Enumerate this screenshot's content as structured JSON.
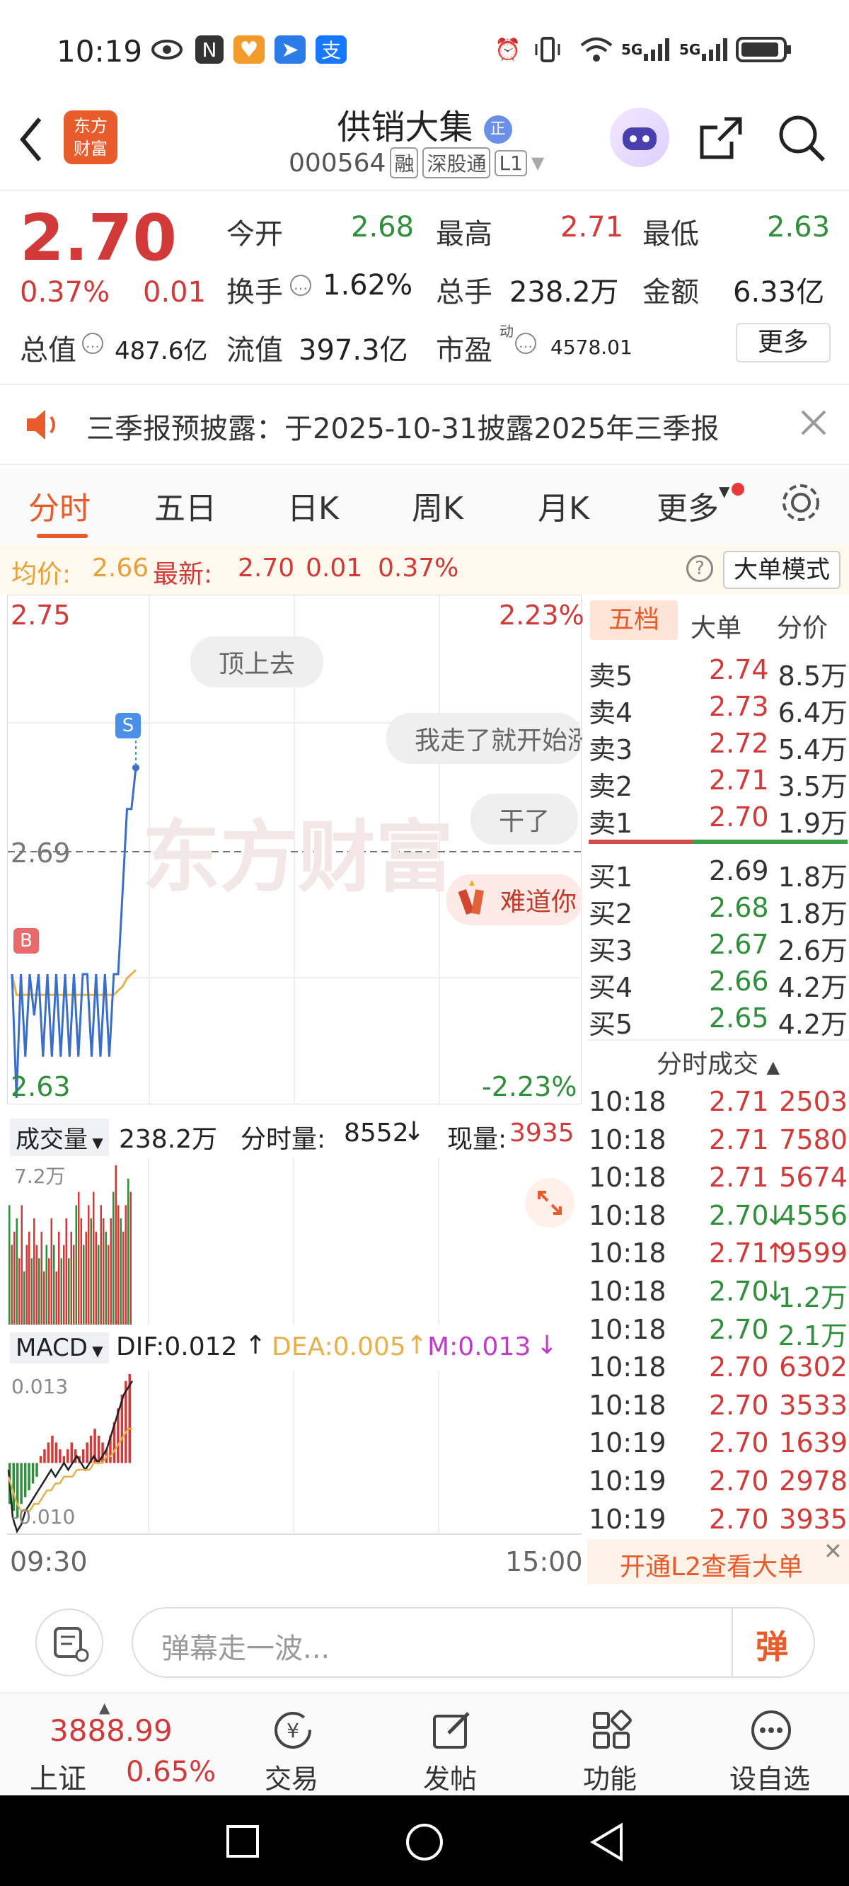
{
  "status_bar": {
    "time": "10:19",
    "signal_1": "5G",
    "signal_2": "5G"
  },
  "header": {
    "logo_text_line1": "东方",
    "logo_text_line2": "财富",
    "stock_name": "供销大集",
    "name_badge": "正",
    "stock_code": "000564",
    "tags": [
      "融",
      "深股通",
      "L1"
    ]
  },
  "quote": {
    "price": "2.70",
    "change_pct": "0.37%",
    "change_abs": "0.01",
    "open_label": "今开",
    "open": "2.68",
    "high_label": "最高",
    "high": "2.71",
    "low_label": "最低",
    "low": "2.63",
    "turnover_label": "换手",
    "turnover": "1.62%",
    "volume_label": "总手",
    "volume": "238.2万",
    "amount_label": "金额",
    "amount": "6.33亿",
    "mktcap_label": "总值",
    "mktcap": "487.6亿",
    "float_label": "流值",
    "float_cap": "397.3亿",
    "pe_label": "市盈",
    "pe_sup": "动",
    "pe": "4578.01",
    "more_button": "更多"
  },
  "notice": {
    "text": "三季报预披露：于2025-10-31披露2025年三季报"
  },
  "tabs": [
    {
      "label": "分时",
      "active": true
    },
    {
      "label": "五日"
    },
    {
      "label": "日K"
    },
    {
      "label": "周K"
    },
    {
      "label": "月K"
    },
    {
      "label": "更多"
    }
  ],
  "info_bar": {
    "avg_label": "均价:",
    "avg": "2.66",
    "latest_label": "最新:",
    "latest": "2.70",
    "chg": "0.01",
    "chg_pct": "0.37%",
    "mode_button": "大单模式"
  },
  "chart_labels": {
    "top_price": "2.75",
    "top_pct": "2.23%",
    "mid_price": "2.69",
    "bottom_price": "2.63",
    "bottom_pct": "-2.23%",
    "watermark": "东方财富",
    "s_marker": "S",
    "b_marker": "B"
  },
  "chart_data": {
    "type": "line",
    "ylim": [
      2.63,
      2.75
    ],
    "mid": 2.69,
    "price": [
      2.66,
      2.63,
      2.66,
      2.64,
      2.66,
      2.65,
      2.66,
      2.64,
      2.66,
      2.64,
      2.66,
      2.64,
      2.66,
      2.64,
      2.66,
      2.64,
      2.66,
      2.66,
      2.64,
      2.66,
      2.64,
      2.66,
      2.64,
      2.66,
      2.66,
      2.68,
      2.7,
      2.7,
      2.71
    ],
    "avg": [
      2.66,
      2.655,
      2.655,
      2.655,
      2.655,
      2.655,
      2.655,
      2.655,
      2.655,
      2.655,
      2.655,
      2.655,
      2.655,
      2.655,
      2.655,
      2.655,
      2.655,
      2.655,
      2.655,
      2.655,
      2.655,
      2.655,
      2.655,
      2.655,
      2.656,
      2.657,
      2.659,
      2.66,
      2.661
    ],
    "volume": [
      9,
      6,
      7,
      8,
      5,
      9,
      4,
      6,
      7,
      5,
      8,
      6,
      5,
      7,
      4,
      6,
      5,
      8,
      6,
      4,
      7,
      5,
      6,
      8,
      5,
      7,
      6,
      9,
      10,
      8,
      6,
      7,
      9,
      8,
      10,
      7,
      6,
      9,
      8,
      7,
      6,
      8,
      10,
      12,
      9,
      8,
      7,
      9,
      11,
      10
    ],
    "macd_hist": [
      -0.006,
      -0.007,
      -0.008,
      -0.006,
      -0.005,
      -0.004,
      -0.003,
      -0.002,
      0.001,
      0.002,
      0.003,
      0.004,
      0.003,
      0.002,
      0.001,
      0.002,
      0.003,
      0.002,
      0.001,
      0.002,
      0.003,
      0.004,
      0.005,
      0.004,
      0.003,
      0.002,
      0.004,
      0.006,
      0.008,
      0.01,
      0.012,
      0.013
    ],
    "dif": [
      -0.001,
      -0.008,
      -0.01,
      -0.009,
      -0.007,
      -0.006,
      -0.005,
      -0.004,
      -0.003,
      -0.002,
      -0.001,
      -0.002,
      -0.001,
      0.0,
      -0.001,
      0.0,
      0.001,
      0.0,
      -0.001,
      0.0,
      0.001,
      0.0,
      0.001,
      0.002,
      0.004,
      0.006,
      0.008,
      0.01,
      0.011,
      0.012
    ],
    "dea": [
      -0.002,
      -0.004,
      -0.006,
      -0.007,
      -0.007,
      -0.007,
      -0.006,
      -0.006,
      -0.005,
      -0.004,
      -0.004,
      -0.003,
      -0.003,
      -0.002,
      -0.002,
      -0.002,
      -0.001,
      -0.001,
      -0.001,
      -0.001,
      0.0,
      0.0,
      0.0,
      0.001,
      0.001,
      0.002,
      0.003,
      0.004,
      0.005,
      0.005
    ],
    "macd_ylim": [
      -0.01,
      0.013
    ]
  },
  "danmaku": [
    "顶上去",
    "我走了就开始涨",
    "干了",
    "难道你"
  ],
  "orderbook": {
    "tabs": [
      "五档",
      "大单",
      "分价"
    ],
    "asks": [
      {
        "label": "卖5",
        "price": "2.74",
        "vol": "8.5万"
      },
      {
        "label": "卖4",
        "price": "2.73",
        "vol": "6.4万"
      },
      {
        "label": "卖3",
        "price": "2.72",
        "vol": "5.4万"
      },
      {
        "label": "卖2",
        "price": "2.71",
        "vol": "3.5万"
      },
      {
        "label": "卖1",
        "price": "2.70",
        "vol": "1.9万"
      }
    ],
    "bids": [
      {
        "label": "买1",
        "price": "2.69",
        "vol": "1.8万"
      },
      {
        "label": "买2",
        "price": "2.68",
        "vol": "1.8万"
      },
      {
        "label": "买3",
        "price": "2.67",
        "vol": "2.6万"
      },
      {
        "label": "买4",
        "price": "2.66",
        "vol": "4.2万"
      },
      {
        "label": "买5",
        "price": "2.65",
        "vol": "4.2万"
      }
    ],
    "trades_title": "分时成交",
    "trades": [
      {
        "time": "10:18",
        "price": "2.71",
        "vol": "2503",
        "dir": "",
        "color": "red"
      },
      {
        "time": "10:18",
        "price": "2.71",
        "vol": "7580",
        "dir": "",
        "color": "red"
      },
      {
        "time": "10:18",
        "price": "2.71",
        "vol": "5674",
        "dir": "",
        "color": "red"
      },
      {
        "time": "10:18",
        "price": "2.70",
        "vol": "4556",
        "dir": "↓",
        "color": "green"
      },
      {
        "time": "10:18",
        "price": "2.71",
        "vol": "9599",
        "dir": "↑",
        "color": "red"
      },
      {
        "time": "10:18",
        "price": "2.70",
        "vol": "1.2万",
        "dir": "↓",
        "color": "green"
      },
      {
        "time": "10:18",
        "price": "2.70",
        "vol": "2.1万",
        "dir": "",
        "color": "green"
      },
      {
        "time": "10:18",
        "price": "2.70",
        "vol": "6302",
        "dir": "",
        "color": "red"
      },
      {
        "time": "10:18",
        "price": "2.70",
        "vol": "3533",
        "dir": "",
        "color": "red"
      },
      {
        "time": "10:19",
        "price": "2.70",
        "vol": "1639",
        "dir": "",
        "color": "red"
      },
      {
        "time": "10:19",
        "price": "2.70",
        "vol": "2978",
        "dir": "",
        "color": "red"
      },
      {
        "time": "10:19",
        "price": "2.70",
        "vol": "3935",
        "dir": "",
        "color": "red"
      }
    ],
    "l2_banner": "开通L2查看大单"
  },
  "volume_bar": {
    "label": "成交量",
    "total": "238.2万",
    "period_label": "分时量:",
    "period": "8552",
    "now_label": "现量:",
    "now": "3935",
    "scale": "7.2万"
  },
  "macd_bar": {
    "label": "MACD",
    "dif": "DIF:0.012",
    "dea": "DEA:0.005",
    "m": "M:0.013",
    "top": "0.013",
    "bottom": "-0.010"
  },
  "time_axis": {
    "start": "09:30",
    "end": "15:00"
  },
  "input": {
    "placeholder": "弹幕走一波...",
    "send": "弹"
  },
  "bottom_nav": {
    "index_value": "3888.99",
    "index_name": "上证",
    "index_pct": "0.65%",
    "items": [
      "交易",
      "发帖",
      "功能",
      "设自选"
    ]
  },
  "colors": {
    "red": "#d23a3a",
    "green": "#2f8f3a",
    "orange": "#e8a13a",
    "accent": "#e85c2b"
  }
}
